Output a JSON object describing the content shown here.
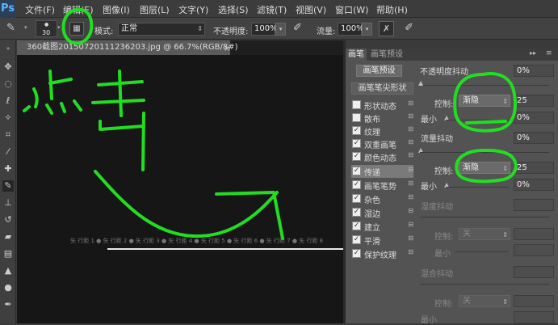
{
  "app": {
    "logo": "Ps"
  },
  "menu": [
    "文件(F)",
    "编辑(E)",
    "图像(I)",
    "图层(L)",
    "文字(Y)",
    "选择(S)",
    "滤镜(T)",
    "视图(V)",
    "窗口(W)",
    "帮助(H)"
  ],
  "options": {
    "brush_size": "30",
    "mode_label": "模式:",
    "mode_value": "正常",
    "opacity_label": "不透明度:",
    "opacity_value": "100%",
    "flow_label": "流量:",
    "flow_value": "100%"
  },
  "document": {
    "tab_title": "360截图20150720111236203.jpg @ 66.7%(RGB/8#)",
    "close": "×",
    "ruler_text": "矢 行距 1 ● 矢 行距 2 ● 矢 行距 3 ● 矢 行距 4 ● 矢 行距 5 ● 矢 行距 6 ● 矢 行距 7 ● 矢 行距 8"
  },
  "panel": {
    "tabs": [
      "画笔",
      "画笔预设"
    ],
    "preset_button": "画笔预设",
    "tip_shape": "画笔笔尖形状",
    "options": [
      {
        "label": "形状动态",
        "checked": false
      },
      {
        "label": "散布",
        "checked": false
      },
      {
        "label": "纹理",
        "checked": true
      },
      {
        "label": "双重画笔",
        "checked": true
      },
      {
        "label": "颜色动态",
        "checked": true
      },
      {
        "label": "传递",
        "checked": true,
        "selected": true
      },
      {
        "label": "画笔笔势",
        "checked": true
      },
      {
        "label": "杂色",
        "checked": true
      },
      {
        "label": "湿边",
        "checked": true
      },
      {
        "label": "建立",
        "checked": true
      },
      {
        "label": "平滑",
        "checked": true
      },
      {
        "label": "保护纹理",
        "checked": true
      }
    ],
    "opacity_jitter": "不透明度抖动",
    "opacity_jitter_value": "0%",
    "control_label": "控制:",
    "control1_value": "渐隐",
    "control1_num": "25",
    "min_label": "最小",
    "min1_value": "0%",
    "flow_jitter": "流量抖动",
    "flow_jitter_value": "0%",
    "control2_value": "渐隐",
    "control2_num": "25",
    "min2_value": "0%",
    "wet_jitter": "湿度抖动",
    "control3_value": "关",
    "min3_label": "最小",
    "mix_jitter": "混合抖动",
    "control4_value": "关",
    "min4_label": "最小",
    "checkmark": "✓",
    "lock": "⊟"
  },
  "annotation": {
    "text": "点击",
    "color": "#22dd22"
  }
}
